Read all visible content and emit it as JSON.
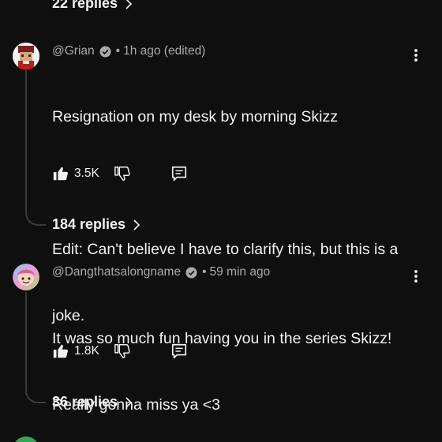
{
  "top_replies": {
    "label": "22 replies"
  },
  "comments": [
    {
      "author": "@Grian",
      "verified": true,
      "time": "1h ago (edited)",
      "text_line1": "Resignation on my desk by morning Skizz",
      "text_line2": "",
      "text_line3": "Edit: Can't believe I have to clarify this, but this is a",
      "text_line4": "joke.",
      "likes": "3.5K",
      "replies": "184 replies",
      "avatar_icon": "pixel-avatar-icon"
    },
    {
      "author": "@Dangthatsalongname",
      "verified": true,
      "time": "59 min ago",
      "text_line1": "It was so much fun having you in the series Skizz!",
      "text_line2": "Really gonna miss ya <3",
      "likes": "1.8K",
      "replies": "36 replies",
      "avatar_icon": "cartoon-avatar-icon"
    }
  ],
  "colors": {
    "background": "#0f0f0f",
    "text_primary": "#f1f1f1",
    "text_secondary": "#aaaaaa",
    "thread_line": "#3a3a3a"
  }
}
